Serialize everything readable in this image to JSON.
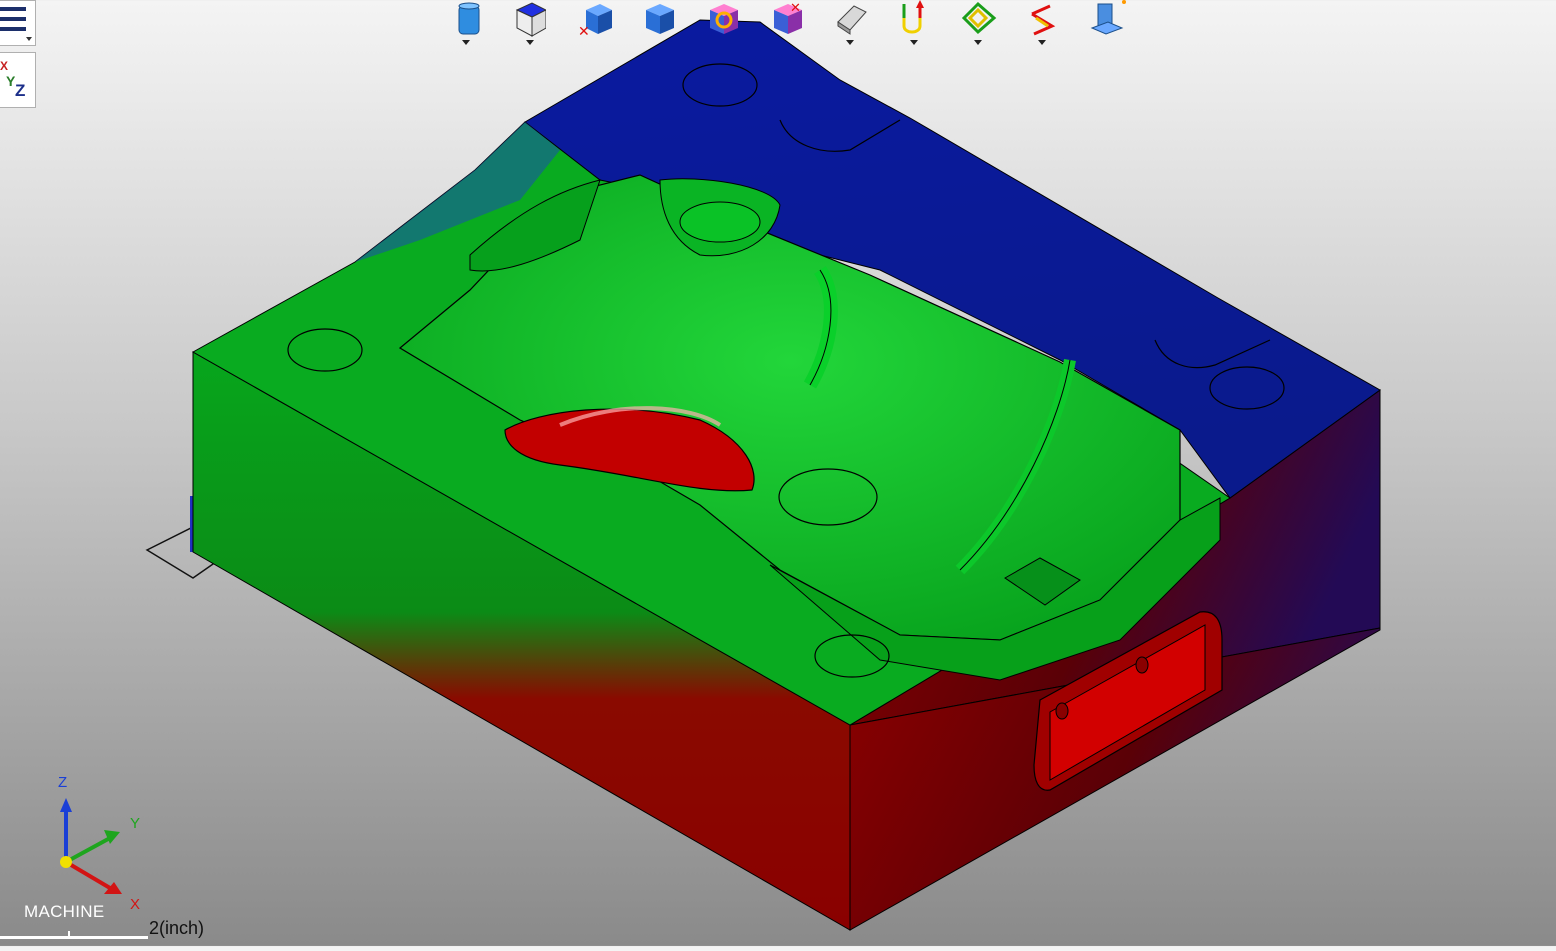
{
  "app": {
    "name": "CAM viewport"
  },
  "side_buttons": [
    {
      "id": "menu",
      "icon": "hamburger-menu-icon"
    },
    {
      "id": "view-axis",
      "icon": "axis-view-icon",
      "labels": {
        "x": "X",
        "y": "Y",
        "z": "Z"
      }
    }
  ],
  "toolbar": {
    "buttons": [
      {
        "icon": "cylinder-stock-icon",
        "dropdown": true
      },
      {
        "icon": "wireframe-box-icon",
        "dropdown": true
      },
      {
        "icon": "remove-stock-icon",
        "dropdown": false
      },
      {
        "icon": "solid-box-icon",
        "dropdown": false
      },
      {
        "icon": "refresh-stock-icon",
        "dropdown": false
      },
      {
        "icon": "delete-stock-icon",
        "dropdown": false
      },
      {
        "icon": "eraser-icon",
        "dropdown": true
      },
      {
        "icon": "toolpath-direction-icon",
        "dropdown": true
      },
      {
        "icon": "contour-toolpath-icon",
        "dropdown": true
      },
      {
        "icon": "rest-toolpath-icon",
        "dropdown": true
      },
      {
        "icon": "machine-simulation-icon",
        "dropdown": false
      }
    ]
  },
  "triad": {
    "x": "X",
    "y": "Y",
    "z": "Z",
    "coordinate_system": "MACHINE"
  },
  "scale": {
    "text": "2(inch)"
  },
  "colors": {
    "blue_region": "#1a1a9c",
    "green_region": "#0aa81f",
    "red_region": "#b00000",
    "background_top": "#f4f4f4",
    "background_bottom": "#8a8a8a"
  }
}
